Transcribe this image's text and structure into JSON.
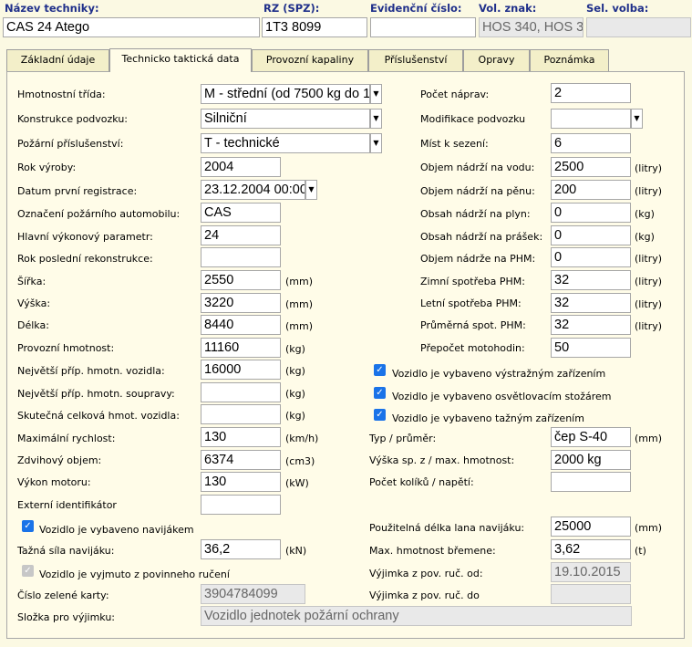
{
  "header": {
    "name_label": "Název techniky:",
    "name_value": "CAS 24 Atego",
    "rz_label": "RZ (SPZ):",
    "rz_value": "1T3 8099",
    "evid_label": "Evidenční číslo:",
    "evid_value": "",
    "vol_label": "Vol. znak:",
    "vol_value": "HOS 340, HOS 3",
    "sel_label": "Sel. volba:",
    "sel_value": ""
  },
  "tabs": [
    "Základní údaje",
    "Technicko taktická data",
    "Provozní kapaliny",
    "Příslušenství",
    "Opravy",
    "Poznámka"
  ],
  "left": {
    "hmot_label": "Hmotnostní třída:",
    "hmot_value": "M - střední (od 7500 kg do 1",
    "konstr_label": "Konstrukce podvozku:",
    "konstr_value": "Silniční",
    "pozar_label": "Požární příslušenství:",
    "pozar_value": "T - technické",
    "rok_label": "Rok výroby:",
    "rok_value": "2004",
    "datum_label": "Datum první registrace:",
    "datum_value": "23.12.2004 00:00",
    "ozn_label": "Označení požárního automobilu:",
    "ozn_value": "CAS",
    "hlavni_label": "Hlavní výkonový parametr:",
    "hlavni_value": "24",
    "rekon_label": "Rok poslední rekonstrukce:",
    "rekon_value": "",
    "sirka_label": "Šířka:",
    "sirka_value": "2550",
    "sirka_unit": "(mm)",
    "vyska_label": "Výška:",
    "vyska_value": "3220",
    "vyska_unit": "(mm)",
    "delka_label": "Délka:",
    "delka_value": "8440",
    "delka_unit": "(mm)",
    "prov_label": "Provozní hmotnost:",
    "prov_value": "11160",
    "prov_unit": "(kg)",
    "nejv_voz_label": "Největší příp. hmotn. vozidla:",
    "nejv_voz_value": "16000",
    "nejv_voz_unit": "(kg)",
    "nejv_soup_label": "Největší příp. hmotn. soupravy:",
    "nejv_soup_value": "",
    "nejv_soup_unit": "(kg)",
    "skut_label": "Skutečná celková hmot. vozidla:",
    "skut_value": "",
    "skut_unit": "(kg)",
    "max_label": "Maximální rychlost:",
    "max_value": "130",
    "max_unit": "(km/h)",
    "zdvih_label": "Zdvihový objem:",
    "zdvih_value": "6374",
    "zdvih_unit": "(cm3)",
    "vykon_label": "Výkon motoru:",
    "vykon_value": "130",
    "vykon_unit": "(kW)",
    "ext_label": "Externí identifikátor",
    "ext_value": "",
    "navijak_label": "Vozidlo je vybaveno navijákem",
    "tazna_label": "Tažná síla navijáku:",
    "tazna_value": "36,2",
    "tazna_unit": "(kN)",
    "vyjm_label": "Vozidlo je vyjmuto z povinneho ručení",
    "zelena_label": "Číslo zelené karty:",
    "zelena_value": "3904784099",
    "slozka_label": "Složka pro výjimku:",
    "slozka_value": "Vozidlo jednotek požární ochrany"
  },
  "right": {
    "naprav_label": "Počet náprav:",
    "naprav_value": "2",
    "modif_label": "Modifikace podvozku",
    "modif_value": "",
    "mist_label": "Míst k sezení:",
    "mist_value": "6",
    "voda_label": "Objem nádrží na vodu:",
    "voda_value": "2500",
    "voda_unit": "(litry)",
    "pena_label": "Objem nádrží na pěnu:",
    "pena_value": "200",
    "pena_unit": "(litry)",
    "plyn_label": "Obsah nádrží na plyn:",
    "plyn_value": "0",
    "plyn_unit": "(kg)",
    "prasek_label": "Obsah nádrží na prášek:",
    "prasek_value": "0",
    "prasek_unit": "(kg)",
    "phm_label": "Objem nádrže na PHM:",
    "phm_value": "0",
    "phm_unit": "(litry)",
    "zimni_label": "Zimní spotřeba PHM:",
    "zimni_value": "32",
    "zimni_unit": "(litry)",
    "letni_label": "Letní spotřeba PHM:",
    "letni_value": "32",
    "letni_unit": "(litry)",
    "prum_label": "Průměrná spot. PHM:",
    "prum_value": "32",
    "prum_unit": "(litry)",
    "prepocet_label": "Přepočet motohodin:",
    "prepocet_value": "50",
    "chk1_label": "Vozidlo je vybaveno výstražným zařízením",
    "chk2_label": "Vozidlo je vybaveno osvětlovacím stožárem",
    "chk3_label": "Vozidlo je vybaveno tažným zařízením",
    "typ_label": "Typ / průměr:",
    "typ_value": "čep S-40",
    "typ_unit": "(mm)",
    "vyska_label": "Výška sp. z / max. hmotnost:",
    "vyska_value": "2000 kg",
    "kolik_label": "Počet kolíků / napětí:",
    "kolik_value": "",
    "lana_label": "Použitelná délka lana navijáku:",
    "lana_value": "25000",
    "lana_unit": "(mm)",
    "bremeno_label": "Max. hmotnost břemene:",
    "bremeno_value": "3,62",
    "bremeno_unit": "(t)",
    "vyjod_label": "Výjimka z pov. ruč. od:",
    "vyjod_value": "19.10.2015",
    "vyjdo_label": "Výjimka z pov. ruč. do",
    "vyjdo_value": ""
  },
  "colors": {
    "header_label": "#1f2f8a",
    "checkbox": "#1a73e8",
    "panel_bg": "#fffce8"
  }
}
